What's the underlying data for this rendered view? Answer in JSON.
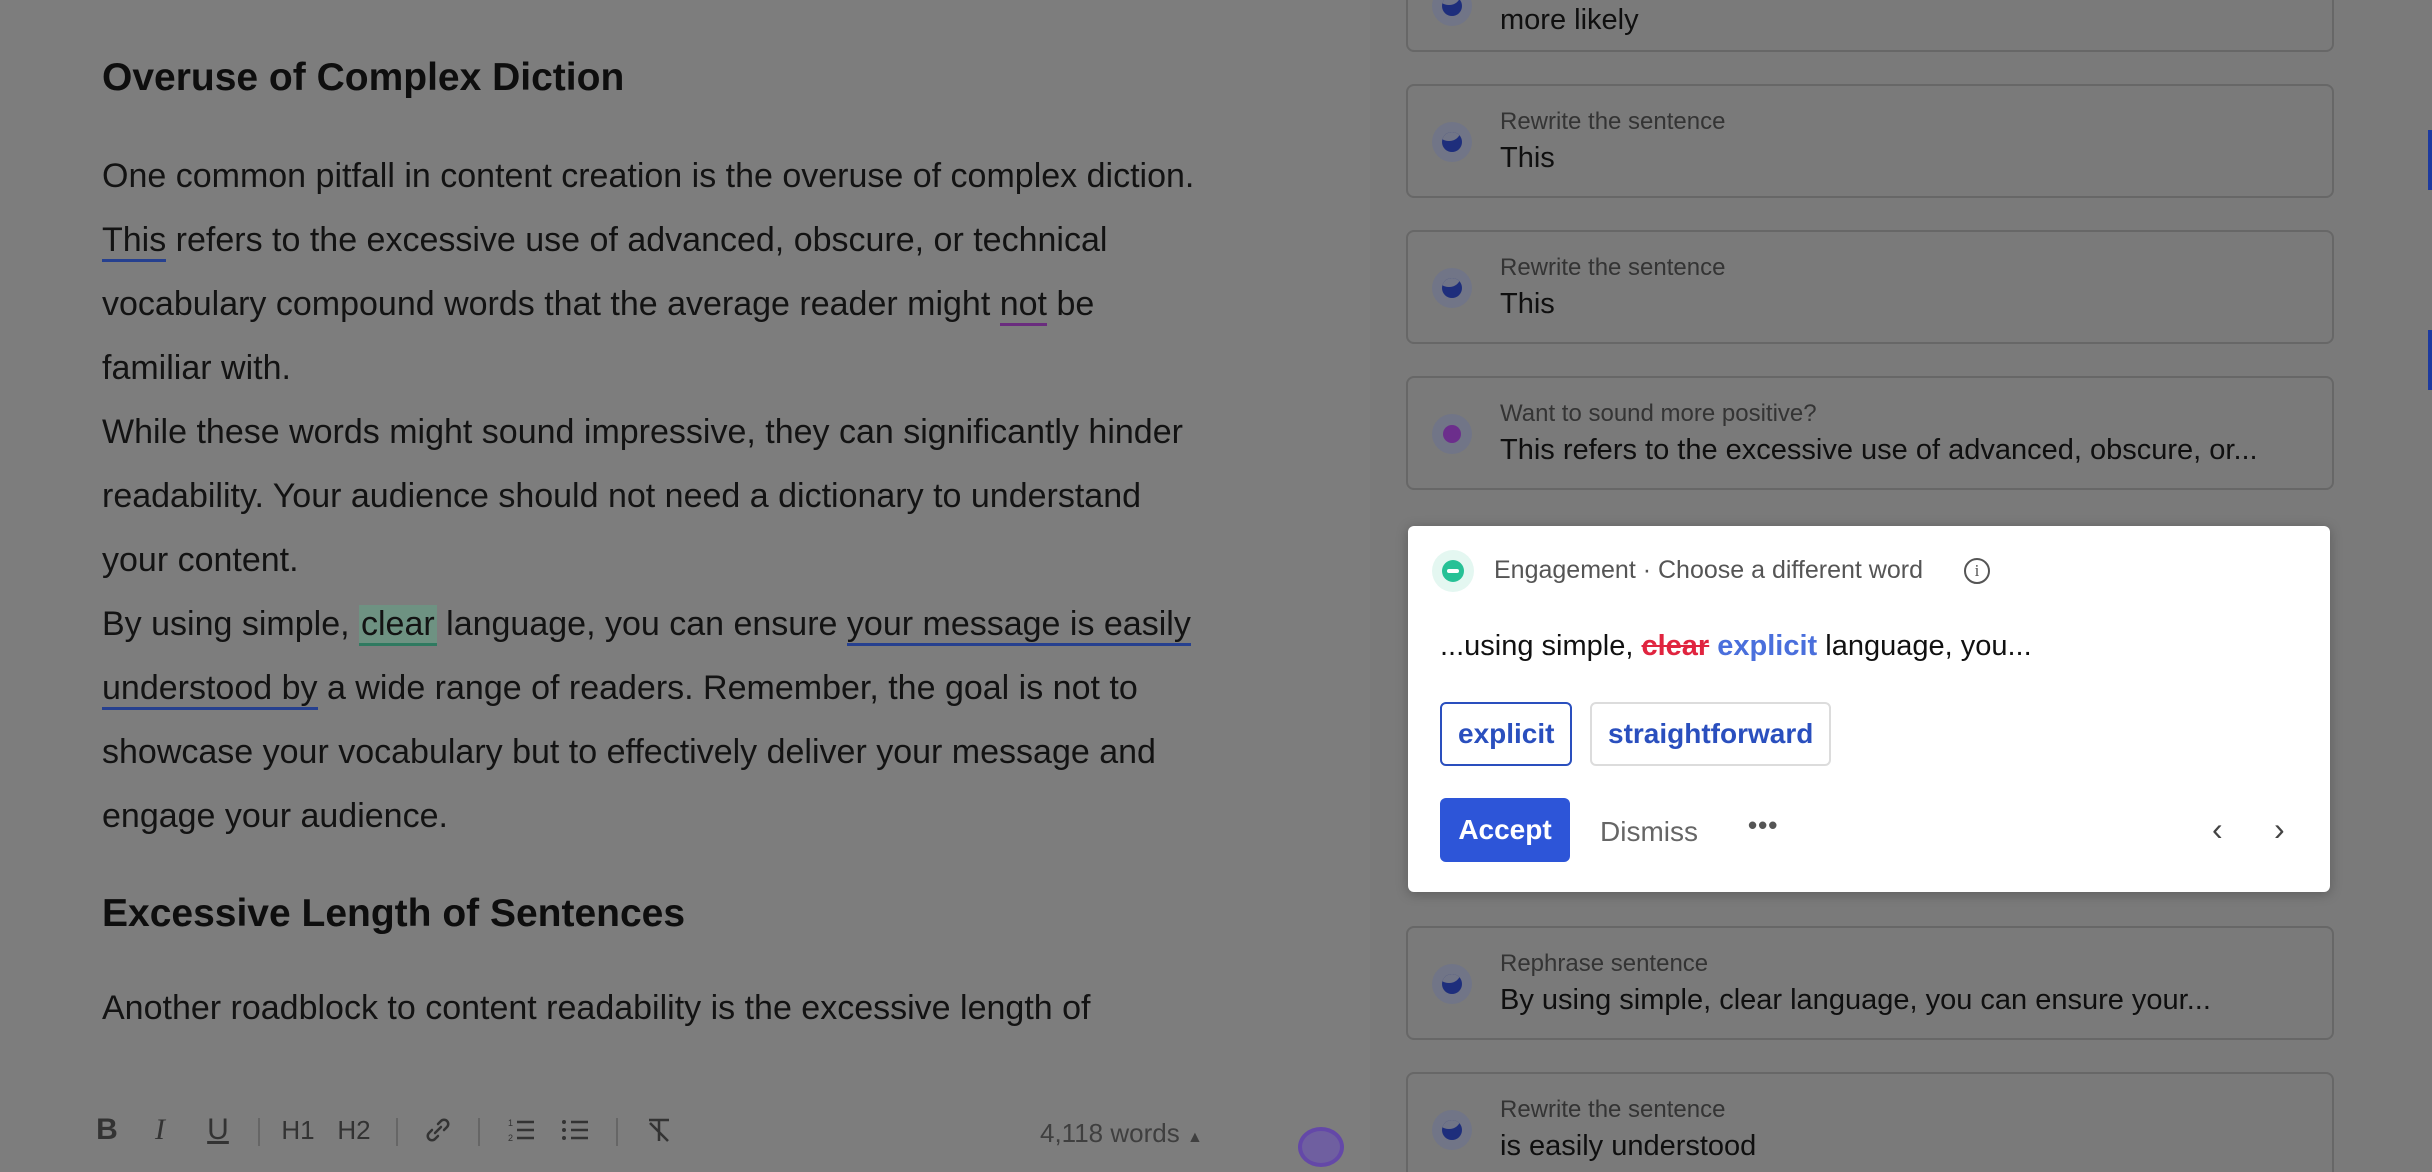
{
  "editor": {
    "heading1": "Overuse of Complex Diction",
    "p1": {
      "t1": "One common pitfall in content creation is the overuse of complex diction.",
      "this": "This",
      "t2": " refers to the excessive use of advanced, obscure, or technical",
      "t3": "vocabulary compound words that the average reader might ",
      "not": "not",
      "t4": " be",
      "t5": "familiar with."
    },
    "p2": {
      "t1": "While these words might sound impressive, they can significantly hinder",
      "t2": "readability. Your audience should not need a dictionary to understand",
      "t3": "your content."
    },
    "p3": {
      "t1": "By using simple, ",
      "clear": "clear",
      "t2": " language, you can ensure ",
      "u1": "your message is easily",
      "u2": "understood by",
      "t3": " a wide range of readers. Remember, the goal is not to",
      "t4": "showcase your vocabulary but to effectively deliver your message and",
      "t5": "engage your audience."
    },
    "heading2": "Excessive Length of Sentences",
    "p4": "Another roadblock to content readability is the excessive length of"
  },
  "toolbar": {
    "bold": "B",
    "italic": "I",
    "underline": "U",
    "h1": "H1",
    "h2": "H2",
    "link_icon": "link-icon",
    "ordered_list_icon": "ordered-list-icon",
    "bullet_list_icon": "bullet-list-icon",
    "clear_format_icon": "clear-format-icon",
    "word_count": "4,118 words"
  },
  "panel": {
    "cards": [
      {
        "caption": "",
        "value": "more likely"
      },
      {
        "caption": "Rewrite the sentence",
        "value": "This"
      },
      {
        "caption": "Rewrite the sentence",
        "value": "This"
      },
      {
        "caption": "Want to sound more positive?",
        "value": "This refers to the excessive use of advanced, obscure, or..."
      },
      {
        "caption": "Rephrase sentence",
        "value": "By using simple, clear language, you can ensure your..."
      },
      {
        "caption": "Rewrite the sentence",
        "value": "is easily understood"
      }
    ],
    "popup": {
      "title": "Engagement · Choose a different word",
      "info": "i",
      "preview_before": "...using simple, ",
      "preview_deleted": "clear",
      "preview_inserted": "explicit",
      "preview_after": " language, you...",
      "options": [
        "explicit",
        "straightforward"
      ],
      "accept": "Accept",
      "dismiss": "Dismiss",
      "more": "•••",
      "prev": "‹",
      "next": "›"
    }
  },
  "colors": {
    "accent": "#2d55d8",
    "deleted": "#e0243f",
    "inserted": "#4a6fdc",
    "engagement": "#27c196"
  }
}
